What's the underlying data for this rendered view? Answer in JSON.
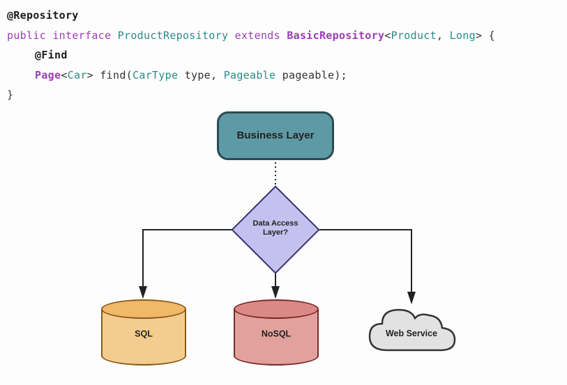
{
  "code": {
    "anno_repository": "@Repository",
    "kw_public": "public",
    "kw_interface": "interface",
    "name_repo": "ProductRepository",
    "kw_extends": "extends",
    "name_base": "BasicRepository",
    "type_product": "Product",
    "type_long": "Long",
    "brace_open": "{",
    "anno_find": "@Find",
    "type_page": "Page",
    "type_car": "Car",
    "method_find": "find",
    "type_cartype": "CarType",
    "param_type": "type",
    "type_pageable": "Pageable",
    "param_pageable": "pageable",
    "stmt_end": ");",
    "brace_close": "}"
  },
  "diagram": {
    "business_layer": "Business Layer",
    "data_access_layer": "Data Access Layer?",
    "sql": "SQL",
    "nosql": "NoSQL",
    "web_service": "Web Service"
  }
}
